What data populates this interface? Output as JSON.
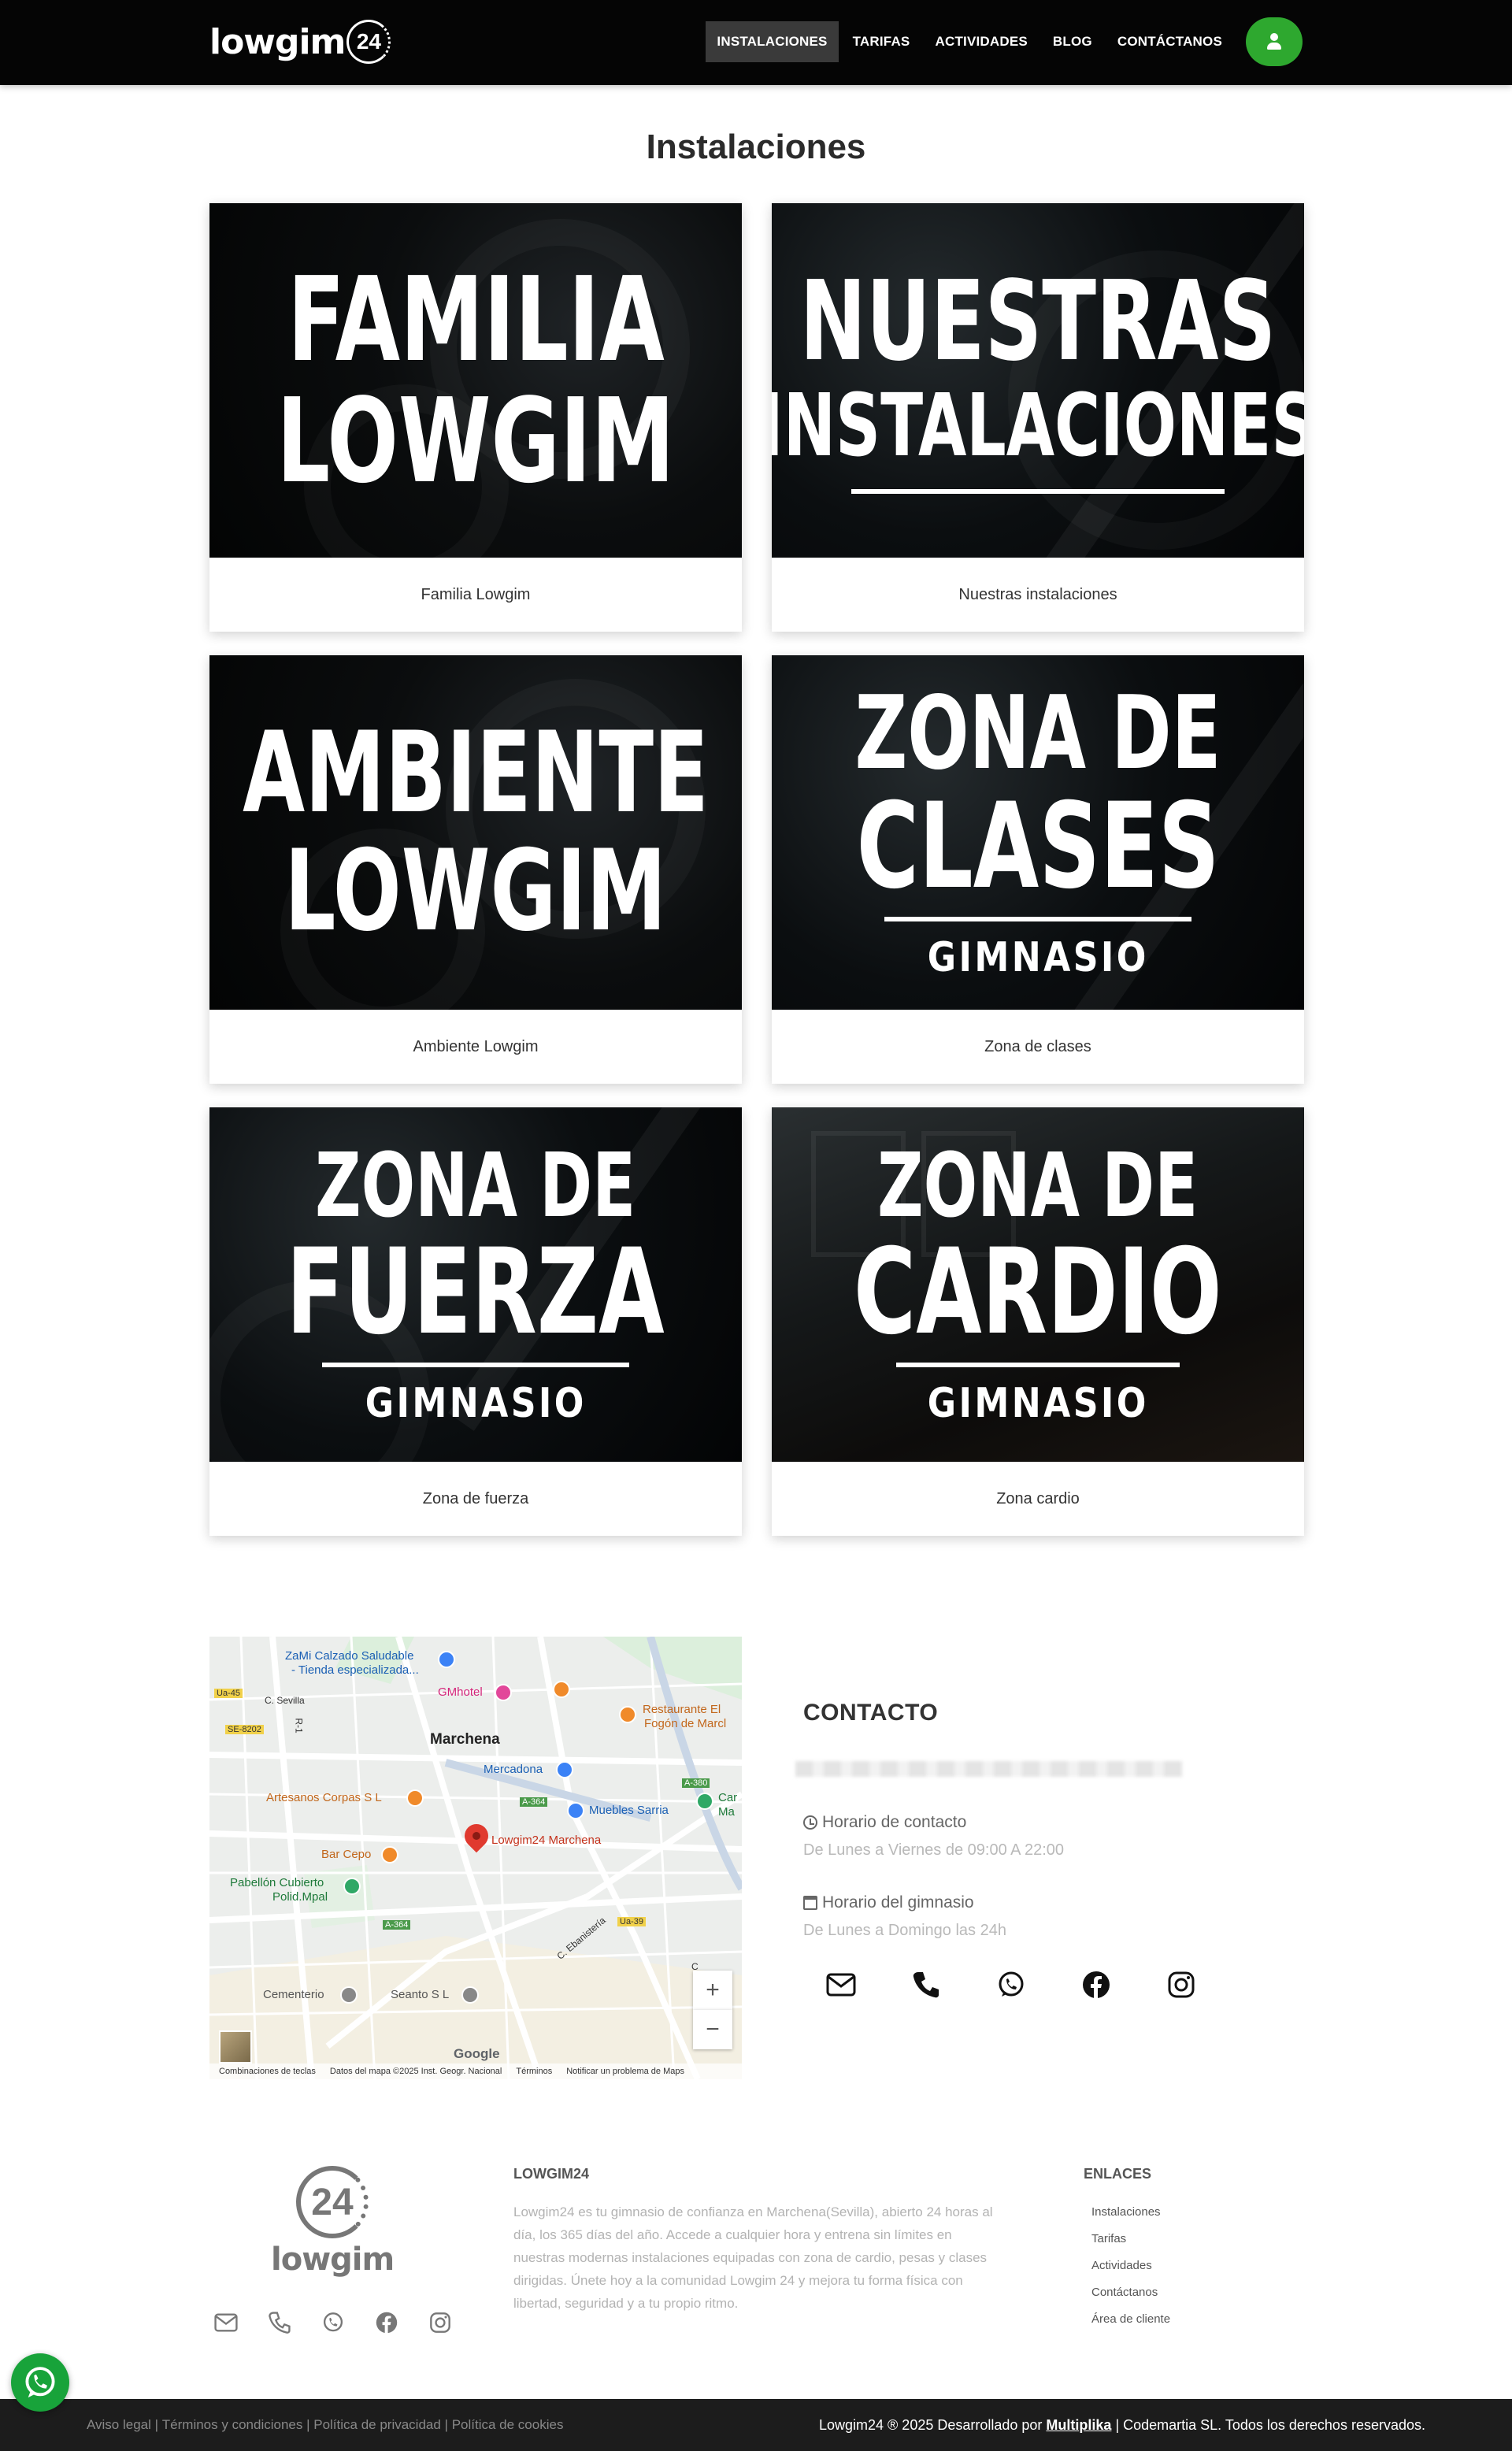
{
  "header": {
    "logo_text": "lowgim",
    "logo_number": "24",
    "nav": [
      {
        "label": "INSTALACIONES",
        "active": true
      },
      {
        "label": "TARIFAS",
        "active": false
      },
      {
        "label": "ACTIVIDADES",
        "active": false
      },
      {
        "label": "BLOG",
        "active": false
      },
      {
        "label": "CONTÁCTANOS",
        "active": false
      }
    ],
    "user_icon": "user-icon",
    "accent_color": "#2ea82f"
  },
  "main": {
    "title": "Instalaciones",
    "cards": [
      {
        "image_lines": [
          "FAMILIA",
          "LOWGIM"
        ],
        "image_sub": "",
        "caption": "Familia Lowgim"
      },
      {
        "image_lines": [
          "NUESTRAS",
          "INSTALACIONES"
        ],
        "image_sub": "",
        "caption": "Nuestras instalaciones"
      },
      {
        "image_lines": [
          "AMBIENTE",
          "LOWGIM"
        ],
        "image_sub": "",
        "caption": "Ambiente Lowgim"
      },
      {
        "image_lines": [
          "ZONA DE",
          "CLASES"
        ],
        "image_sub": "GIMNASIO",
        "caption": "Zona de clases"
      },
      {
        "image_lines": [
          "ZONA DE",
          "FUERZA"
        ],
        "image_sub": "GIMNASIO",
        "caption": "Zona de fuerza"
      },
      {
        "image_lines": [
          "ZONA DE",
          "CARDIO"
        ],
        "image_sub": "GIMNASIO",
        "caption": "Zona cardio"
      }
    ]
  },
  "map": {
    "labels": {
      "zami": "ZaMi Calzado Saludable",
      "zami2": "- Tienda especializada...",
      "gmhotel": "GMhotel",
      "restaurante": "Restaurante El",
      "restaurante2": "Fogón de Marcl",
      "marchena": "Marchena",
      "mercadona": "Mercadona",
      "artesanos": "Artesanos Corpas S L",
      "muebles": "Muebles Sarria",
      "car": "Car",
      "ma": "Ma",
      "lowgim": "Lowgim24 Marchena",
      "barcepo": "Bar Cepo",
      "pabellon": "Pabellón Cubierto",
      "pabellon2": "Polid.Mpal",
      "cementerio": "Cementerio",
      "seanto": "Seanto S L",
      "c_sevilla": "C. Sevilla",
      "c_ebanisteria": "C. Ebanistería",
      "r1": "R-1",
      "c_letter": "C",
      "ua45": "Ua-45",
      "se8202": "SE-8202",
      "a364a": "A-364",
      "a364b": "A-364",
      "a380": "A-380",
      "ua39": "Ua-39",
      "google": "Google"
    },
    "zoom_in": "+",
    "zoom_out": "−",
    "footer": [
      "Combinaciones de teclas",
      "Datos del mapa ©2025 Inst. Geogr. Nacional",
      "Términos",
      "Notificar un problema de Maps"
    ]
  },
  "contact": {
    "title": "CONTACTO",
    "hours_label": "Horario de contacto",
    "hours_value": "De Lunes a Viernes de 09:00 A 22:00",
    "gym_label": "Horario del gimnasio",
    "gym_value": "De Lunes a Domingo las 24h",
    "social_icons": [
      "envelope-icon",
      "phone-icon",
      "whatsapp-icon",
      "facebook-icon",
      "instagram-icon"
    ]
  },
  "footer": {
    "logo_number": "24",
    "logo_text": "lowgim",
    "about_title": "LOWGIM24",
    "about_text": "Lowgim24 es tu gimnasio de confianza en Marchena(Sevilla), abierto 24 horas al día, los 365 días del año. Accede a cualquier hora y entrena sin límites en nuestras modernas instalaciones equipadas con zona de cardio, pesas y clases dirigidas. Únete hoy a la comunidad Lowgim 24 y mejora tu forma física con libertad, seguridad y a tu propio ritmo.",
    "links_title": "ENLACES",
    "links": [
      "Instalaciones",
      "Tarifas",
      "Actividades",
      "Contáctanos",
      "Área de cliente"
    ],
    "legal": [
      "Aviso legal",
      "Términos y condiciones",
      "Política de privacidad",
      "Política de cookies"
    ],
    "legal_sep": " | ",
    "copyright_pre": "Lowgim24 ® 2025 Desarrollado por ",
    "copyright_brand": "Multiplika",
    "copyright_post": " | Codemartia SL. Todos los derechos reservados."
  }
}
